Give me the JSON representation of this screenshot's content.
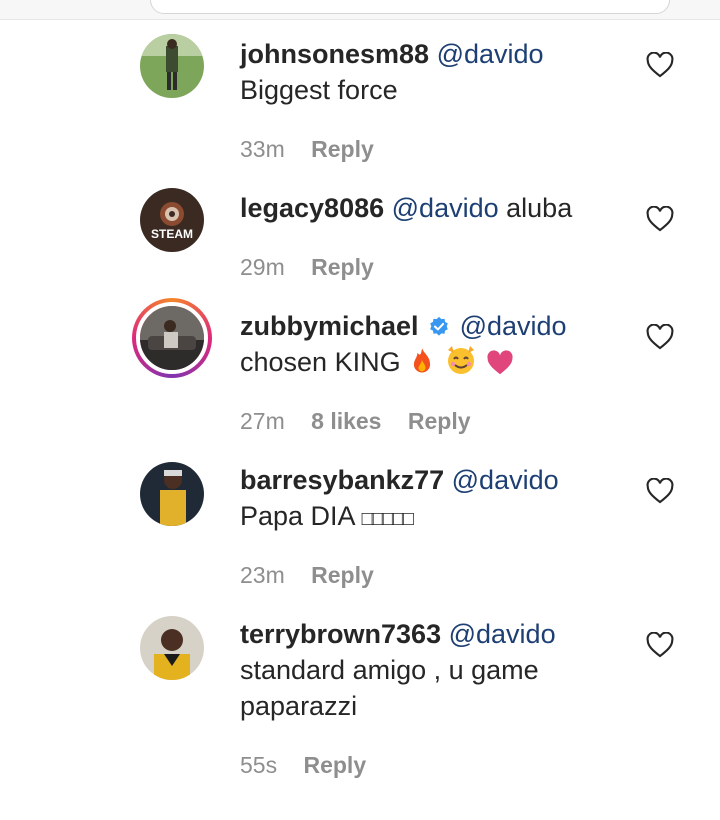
{
  "comments": [
    {
      "username": "johnsonesm88",
      "mention": "@davido",
      "text": "Biggest force",
      "time": "33m",
      "likes": "",
      "reply": "Reply"
    },
    {
      "username": "legacy8086",
      "mention": "@davido",
      "text": "aluba",
      "time": "29m",
      "likes": "",
      "reply": "Reply",
      "avatar_text": "STEAM"
    },
    {
      "username": "zubbymichael",
      "mention": "@davido",
      "text": "chosen KING",
      "time": "27m",
      "likes": "8 likes",
      "reply": "Reply",
      "verified": true,
      "emojis": [
        "fire-emoji",
        "smiling-face-emoji",
        "heart-emoji"
      ]
    },
    {
      "username": "barresybankz77",
      "mention": "@davido",
      "text": "Papa DIA",
      "missing_glyphs": "□□□□□",
      "time": "23m",
      "likes": "",
      "reply": "Reply"
    },
    {
      "username": "terrybrown7363",
      "mention": "@davido",
      "text": "standard amigo , u game paparazzi",
      "time": "55s",
      "likes": "",
      "reply": "Reply"
    }
  ],
  "colors": {
    "mention": "#1d3f73",
    "meta": "#8e8e8e",
    "verified": "#3897f0"
  }
}
